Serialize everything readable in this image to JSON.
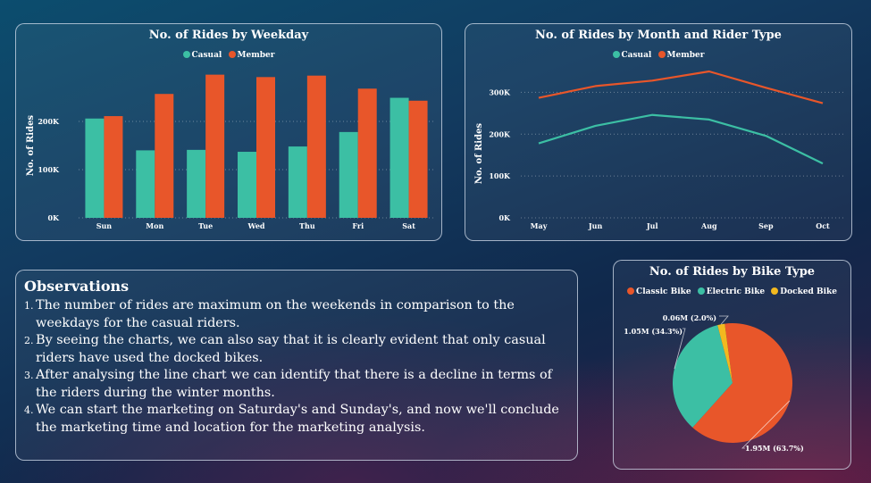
{
  "colors": {
    "casual": "#3cbfa4",
    "member": "#e8562a",
    "classic": "#e8562a",
    "electric": "#3cbfa4",
    "docked": "#f2b91f"
  },
  "weekday_chart": {
    "title": "No. of Rides by Weekday",
    "legend": [
      {
        "label": "Casual",
        "color": "#3cbfa4"
      },
      {
        "label": "Member",
        "color": "#e8562a"
      }
    ]
  },
  "month_chart": {
    "title": "No. of Rides by Month and Rider Type",
    "legend": [
      {
        "label": "Casual",
        "color": "#3cbfa4"
      },
      {
        "label": "Member",
        "color": "#e8562a"
      }
    ]
  },
  "bike_chart": {
    "title": "No. of Rides by Bike Type",
    "legend": [
      {
        "label": "Classic Bike",
        "color": "#e8562a"
      },
      {
        "label": "Electric Bike",
        "color": "#3cbfa4"
      },
      {
        "label": "Docked Bike",
        "color": "#f2b91f"
      }
    ]
  },
  "observations": {
    "title": "Observations",
    "items": [
      {
        "num": "1.",
        "text": "The number of rides are maximum on the weekends in comparison to the weekdays for the casual riders."
      },
      {
        "num": "2.",
        "text": "By seeing the charts, we can also say that it is clearly evident that only casual riders have used the docked bikes."
      },
      {
        "num": "3.",
        "text": "After analysing the line chart we can identify that there is a decline in terms of the riders during the winter months."
      },
      {
        "num": "4.",
        "text": "We can start the marketing on Saturday's and Sunday's, and now we'll conclude the marketing time and location for the marketing analysis."
      }
    ]
  },
  "chart_data": [
    {
      "type": "bar",
      "title": "No. of Rides by Weekday",
      "xlabel": "",
      "ylabel": "No. of Rides",
      "categories": [
        "Sun",
        "Mon",
        "Tue",
        "Wed",
        "Thu",
        "Fri",
        "Sat"
      ],
      "series": [
        {
          "name": "Casual",
          "color": "#3cbfa4",
          "values": [
            206000,
            140000,
            141000,
            137000,
            148000,
            178000,
            249000
          ]
        },
        {
          "name": "Member",
          "color": "#e8562a",
          "values": [
            211000,
            257000,
            297000,
            292000,
            295000,
            268000,
            243000
          ]
        }
      ],
      "ylim": [
        0,
        300000
      ],
      "yticks": [
        {
          "value": 0,
          "label": "0K"
        },
        {
          "value": 100000,
          "label": "100K"
        },
        {
          "value": 200000,
          "label": "200K"
        }
      ],
      "grid": true,
      "legend": "top-center"
    },
    {
      "type": "line",
      "title": "No. of Rides by Month and Rider Type",
      "xlabel": "",
      "ylabel": "No. of Rides",
      "categories": [
        "May",
        "Jun",
        "Jul",
        "Aug",
        "Sep",
        "Oct"
      ],
      "series": [
        {
          "name": "Casual",
          "color": "#3cbfa4",
          "values": [
            178000,
            220000,
            246000,
            235000,
            196000,
            130000
          ]
        },
        {
          "name": "Member",
          "color": "#e8562a",
          "values": [
            287000,
            315000,
            328000,
            350000,
            311000,
            274000
          ]
        }
      ],
      "ylim": [
        0,
        350000
      ],
      "yticks": [
        {
          "value": 0,
          "label": "0K"
        },
        {
          "value": 100000,
          "label": "100K"
        },
        {
          "value": 200000,
          "label": "200K"
        },
        {
          "value": 300000,
          "label": "300K"
        }
      ],
      "grid": true,
      "legend": "top-center"
    },
    {
      "type": "pie",
      "title": "No. of Rides by Bike Type",
      "slices": [
        {
          "label": "Classic Bike",
          "value": 1950000,
          "percent": 63.7,
          "data_label": "1.95M (63.7%)",
          "color": "#e8562a"
        },
        {
          "label": "Electric Bike",
          "value": 1050000,
          "percent": 34.3,
          "data_label": "1.05M (34.3%)",
          "color": "#3cbfa4"
        },
        {
          "label": "Docked Bike",
          "value": 60000,
          "percent": 2.0,
          "data_label": "0.06M (2.0%)",
          "color": "#f2b91f"
        }
      ],
      "legend": "top-center"
    }
  ]
}
